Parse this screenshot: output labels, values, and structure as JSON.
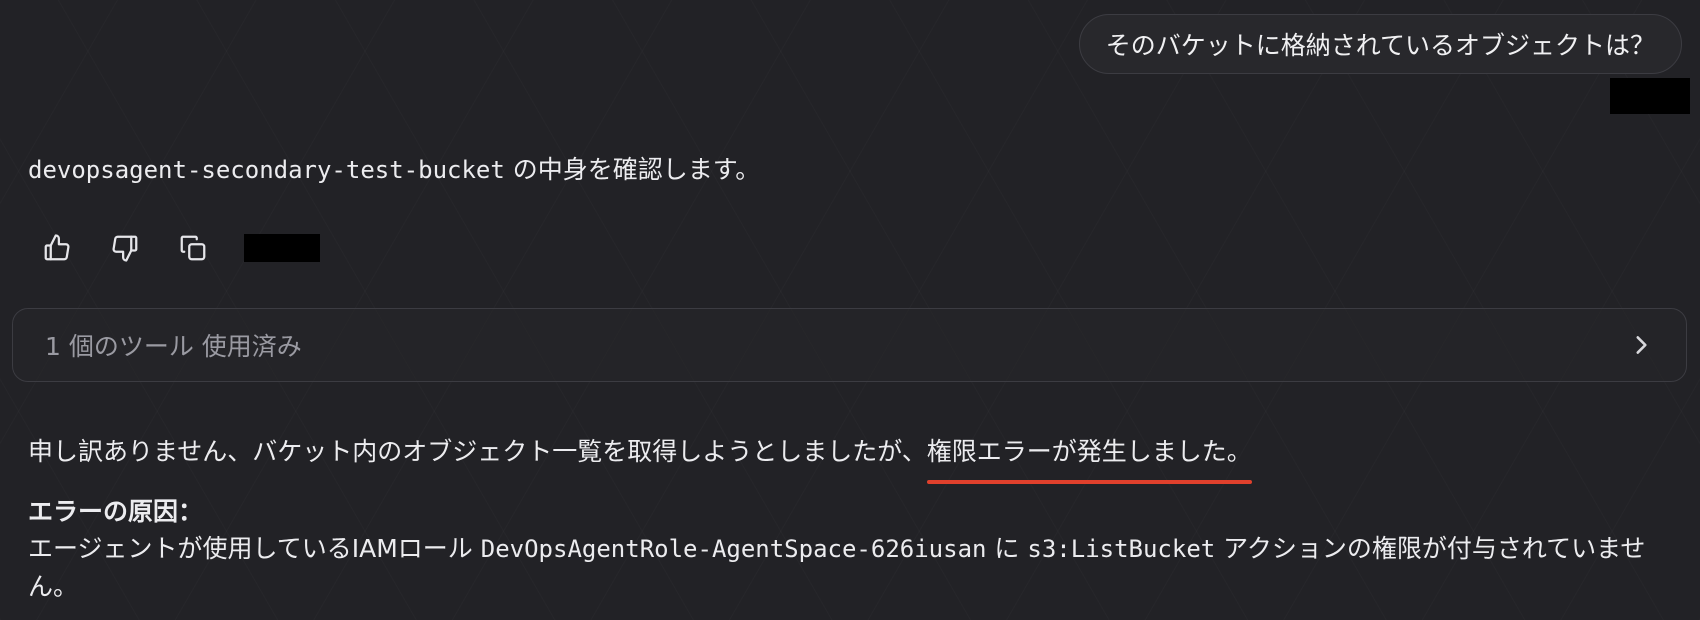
{
  "user_message": "そのバケットに格納されているオブジェクトは？",
  "intro": {
    "bucket_name": "devopsagent-secondary-test-bucket",
    "text": " の中身を確認します。"
  },
  "actions": {
    "thumbs_up": "thumbs-up-icon",
    "thumbs_down": "thumbs-down-icon",
    "copy": "copy-icon"
  },
  "tool_usage": {
    "label": "1 個のツール 使用済み",
    "icon": "chevron-right-icon"
  },
  "response": {
    "para1_text": "申し訳ありません、バケット内のオブジェクト一覧を取得しようとしましたが、",
    "para1_highlight": "権限エラーが発生しました。",
    "cause_title": "エラーの原因：",
    "cause_pre": "エージェントが使用しているIAMロール ",
    "role_name": "DevOpsAgentRole-AgentSpace-626iusan",
    "cause_mid": " に ",
    "action_name": "s3:ListBucket",
    "cause_post": " アクションの権限が付与されていません。"
  },
  "colors": {
    "background": "#222226",
    "highlight_underline": "#e0402c"
  }
}
